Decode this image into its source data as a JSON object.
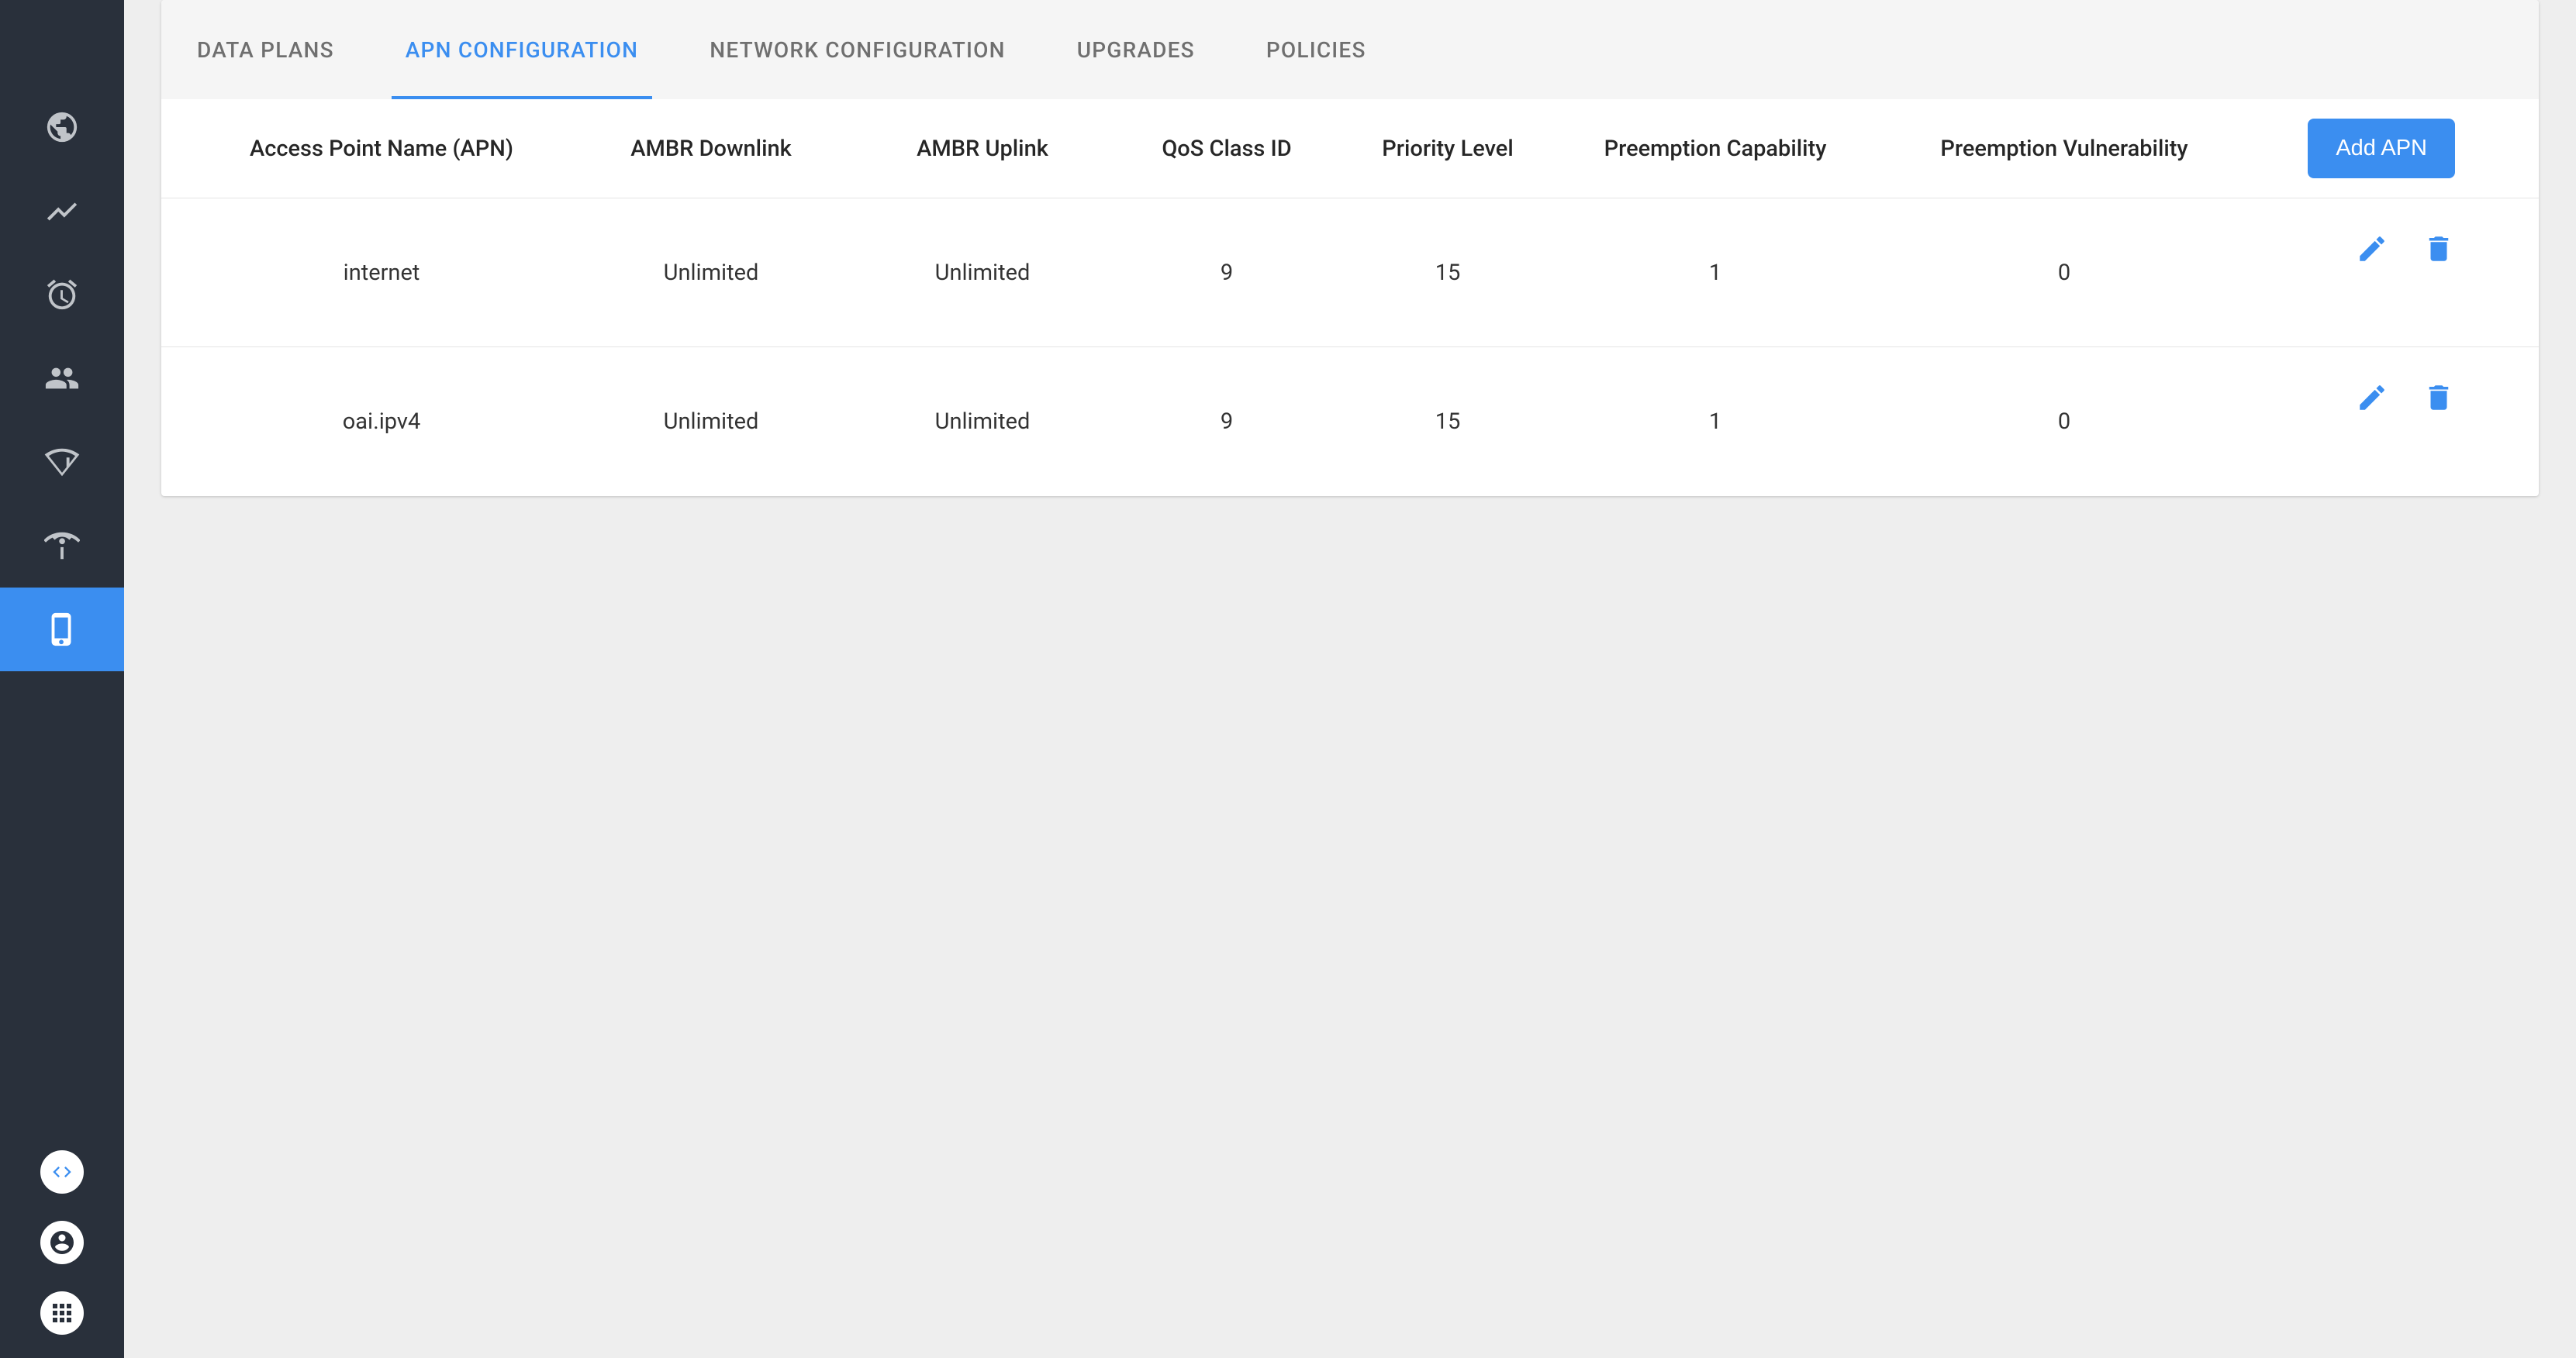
{
  "sidebar": {
    "items": [
      {
        "name": "globe"
      },
      {
        "name": "trending"
      },
      {
        "name": "alarm"
      },
      {
        "name": "people"
      },
      {
        "name": "signal"
      },
      {
        "name": "antenna"
      },
      {
        "name": "phone",
        "active": true
      }
    ],
    "bottom": [
      {
        "name": "code"
      },
      {
        "name": "account"
      },
      {
        "name": "apps"
      }
    ]
  },
  "tabs": [
    {
      "label": "DATA PLANS"
    },
    {
      "label": "APN CONFIGURATION",
      "active": true
    },
    {
      "label": "NETWORK CONFIGURATION"
    },
    {
      "label": "UPGRADES"
    },
    {
      "label": "POLICIES"
    }
  ],
  "columns": {
    "apn": "Access Point Name (APN)",
    "downlink": "AMBR Downlink",
    "uplink": "AMBR Uplink",
    "qos": "QoS Class ID",
    "priority": "Priority Level",
    "precap": "Preemption Capability",
    "prevul": "Preemption Vulnerability"
  },
  "add_button": "Add APN",
  "rows": [
    {
      "apn": "internet",
      "downlink": "Unlimited",
      "uplink": "Unlimited",
      "qos": "9",
      "priority": "15",
      "precap": "1",
      "prevul": "0"
    },
    {
      "apn": "oai.ipv4",
      "downlink": "Unlimited",
      "uplink": "Unlimited",
      "qos": "9",
      "priority": "15",
      "precap": "1",
      "prevul": "0"
    }
  ]
}
